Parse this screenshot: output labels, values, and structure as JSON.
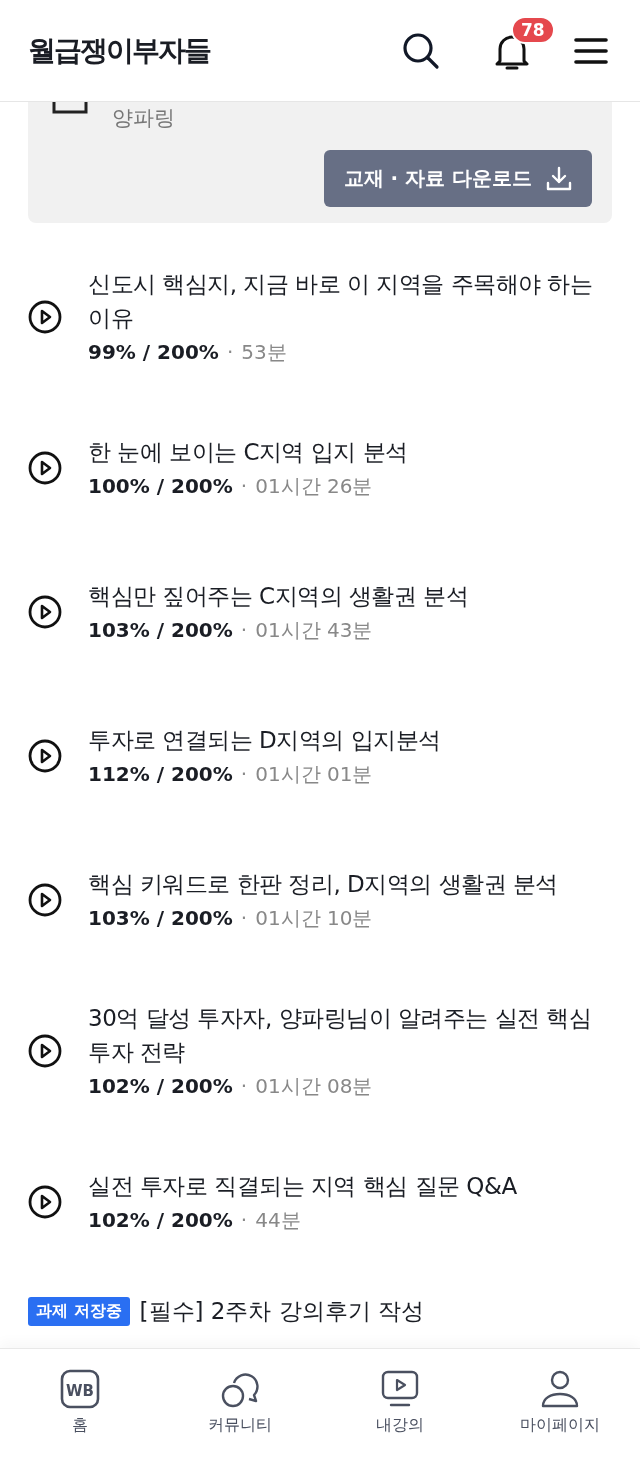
{
  "header": {
    "logo": "월급쟁이부자들",
    "notification_count": "78"
  },
  "material_card": {
    "author": "양파링",
    "download_button": "교재 · 자료 다운로드"
  },
  "lectures": [
    {
      "title": "신도시 핵심지, 지금 바로 이 지역을 주목해야 하는 이유",
      "progress": "99% / 200%",
      "separator": "·",
      "duration": "53분"
    },
    {
      "title": "한 눈에 보이는 C지역 입지 분석",
      "progress": "100% / 200%",
      "separator": "·",
      "duration": "01시간 26분"
    },
    {
      "title": "핵심만 짚어주는 C지역의 생활권 분석",
      "progress": "103% / 200%",
      "separator": "·",
      "duration": "01시간 43분"
    },
    {
      "title": "투자로 연결되는 D지역의 입지분석",
      "progress": "112% / 200%",
      "separator": "·",
      "duration": "01시간 01분"
    },
    {
      "title": "핵심 키워드로 한판 정리, D지역의 생활권 분석",
      "progress": "103% / 200%",
      "separator": "·",
      "duration": "01시간 10분"
    },
    {
      "title": "30억 달성 투자자, 양파링님이 알려주는 실전 핵심 투자 전략",
      "progress": "102% / 200%",
      "separator": "·",
      "duration": "01시간 08분"
    },
    {
      "title": "실전 투자로 직결되는 지역 핵심 질문 Q&A",
      "progress": "102% / 200%",
      "separator": "·",
      "duration": "44분"
    }
  ],
  "assignment": {
    "badge": "과제 저장중",
    "title": "[필수] 2주차 강의후기 작성"
  },
  "bottom_nav": [
    {
      "kind": "home",
      "label": "홈",
      "icon_text": "WB"
    },
    {
      "kind": "community",
      "label": "커뮤니티"
    },
    {
      "kind": "lectures",
      "label": "내강의"
    },
    {
      "kind": "mypage",
      "label": "마이페이지"
    }
  ]
}
